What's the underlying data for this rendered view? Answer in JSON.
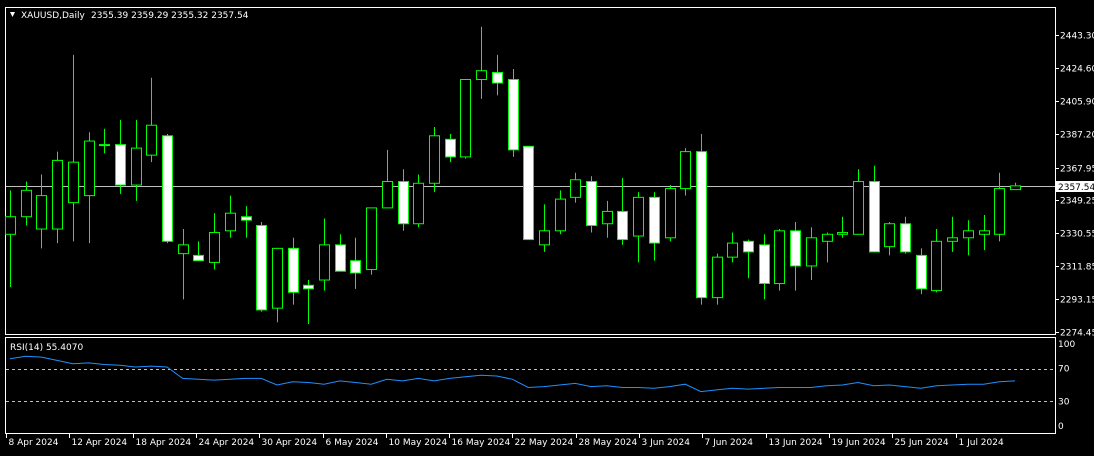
{
  "header": {
    "symbol_timeframe": "XAUUSD,Daily",
    "ohlc": "2355.39 2359.29 2355.32 2357.54"
  },
  "rsi_panel": {
    "label": "RSI(14) 55.4070",
    "levels": [
      "100",
      "70",
      "30",
      "0"
    ]
  },
  "current_price_label": "2357.54",
  "colors": {
    "background": "#000000",
    "candle_outline": "#00ff00",
    "bull_body": "#000000",
    "bear_body": "#ffffff",
    "rsi_line": "#1e90ff",
    "grid_text": "#ffffff"
  },
  "chart_data": [
    {
      "type": "candlestick",
      "title": "XAUUSD,Daily",
      "ylim": [
        2268,
        2463
      ],
      "y_ticks": [
        "2443.30",
        "2424.60",
        "2405.90",
        "2387.20",
        "2367.95",
        "2349.25",
        "2330.55",
        "2311.85",
        "2293.15",
        "2274.45"
      ],
      "x_ticks": [
        "8 Apr 2024",
        "12 Apr 2024",
        "18 Apr 2024",
        "24 Apr 2024",
        "30 Apr 2024",
        "6 May 2024",
        "10 May 2024",
        "16 May 2024",
        "22 May 2024",
        "28 May 2024",
        "3 Jun 2024",
        "7 Jun 2024",
        "13 Jun 2024",
        "19 Jun 2024",
        "25 Jun 2024",
        "1 Jul 2024"
      ],
      "candles": [
        {
          "o": 2330,
          "h": 2355,
          "l": 2300,
          "c": 2340
        },
        {
          "o": 2340,
          "h": 2360,
          "l": 2335,
          "c": 2355
        },
        {
          "o": 2333,
          "h": 2364,
          "l": 2322,
          "c": 2352
        },
        {
          "o": 2333,
          "h": 2377,
          "l": 2325,
          "c": 2372
        },
        {
          "o": 2348,
          "h": 2432,
          "l": 2326,
          "c": 2371
        },
        {
          "o": 2352,
          "h": 2388,
          "l": 2325,
          "c": 2383
        },
        {
          "o": 2381,
          "h": 2390,
          "l": 2376,
          "c": 2381
        },
        {
          "o": 2381,
          "h": 2395,
          "l": 2353,
          "c": 2358
        },
        {
          "o": 2358,
          "h": 2395,
          "l": 2349,
          "c": 2379
        },
        {
          "o": 2375,
          "h": 2419,
          "l": 2371,
          "c": 2392
        },
        {
          "o": 2386,
          "h": 2387,
          "l": 2325,
          "c": 2326
        },
        {
          "o": 2319,
          "h": 2333,
          "l": 2293,
          "c": 2324
        },
        {
          "o": 2318,
          "h": 2326,
          "l": 2315,
          "c": 2315
        },
        {
          "o": 2314,
          "h": 2342,
          "l": 2310,
          "c": 2331
        },
        {
          "o": 2332,
          "h": 2352,
          "l": 2328,
          "c": 2342
        },
        {
          "o": 2340,
          "h": 2346,
          "l": 2328,
          "c": 2338
        },
        {
          "o": 2335,
          "h": 2337,
          "l": 2286,
          "c": 2287
        },
        {
          "o": 2288,
          "h": 2322,
          "l": 2280,
          "c": 2322
        },
        {
          "o": 2322,
          "h": 2328,
          "l": 2290,
          "c": 2297
        },
        {
          "o": 2301,
          "h": 2304,
          "l": 2279,
          "c": 2299
        },
        {
          "o": 2304,
          "h": 2339,
          "l": 2298,
          "c": 2324
        },
        {
          "o": 2324,
          "h": 2330,
          "l": 2315,
          "c": 2309
        },
        {
          "o": 2315,
          "h": 2328,
          "l": 2299,
          "c": 2308
        },
        {
          "o": 2310,
          "h": 2342,
          "l": 2307,
          "c": 2345
        },
        {
          "o": 2345,
          "h": 2378,
          "l": 2345,
          "c": 2360
        },
        {
          "o": 2360,
          "h": 2367,
          "l": 2332,
          "c": 2336
        },
        {
          "o": 2336,
          "h": 2364,
          "l": 2334,
          "c": 2359
        },
        {
          "o": 2359,
          "h": 2391,
          "l": 2354,
          "c": 2386
        },
        {
          "o": 2384,
          "h": 2387,
          "l": 2371,
          "c": 2374
        },
        {
          "o": 2374,
          "h": 2418,
          "l": 2373,
          "c": 2418
        },
        {
          "o": 2418,
          "h": 2448,
          "l": 2407,
          "c": 2423
        },
        {
          "o": 2422,
          "h": 2432,
          "l": 2409,
          "c": 2416
        },
        {
          "o": 2418,
          "h": 2424,
          "l": 2374,
          "c": 2378
        },
        {
          "o": 2380,
          "h": 2380,
          "l": 2330,
          "c": 2327
        },
        {
          "o": 2324,
          "h": 2347,
          "l": 2320,
          "c": 2332
        },
        {
          "o": 2332,
          "h": 2355,
          "l": 2330,
          "c": 2350
        },
        {
          "o": 2351,
          "h": 2365,
          "l": 2348,
          "c": 2361
        },
        {
          "o": 2360,
          "h": 2363,
          "l": 2331,
          "c": 2335
        },
        {
          "o": 2336,
          "h": 2349,
          "l": 2328,
          "c": 2343
        },
        {
          "o": 2343,
          "h": 2362,
          "l": 2324,
          "c": 2327
        },
        {
          "o": 2329,
          "h": 2354,
          "l": 2314,
          "c": 2351
        },
        {
          "o": 2351,
          "h": 2354,
          "l": 2315,
          "c": 2325
        },
        {
          "o": 2328,
          "h": 2358,
          "l": 2326,
          "c": 2356
        },
        {
          "o": 2356,
          "h": 2379,
          "l": 2352,
          "c": 2377
        },
        {
          "o": 2377,
          "h": 2387,
          "l": 2290,
          "c": 2294
        },
        {
          "o": 2294,
          "h": 2319,
          "l": 2290,
          "c": 2317
        },
        {
          "o": 2317,
          "h": 2331,
          "l": 2314,
          "c": 2325
        },
        {
          "o": 2326,
          "h": 2327,
          "l": 2305,
          "c": 2320
        },
        {
          "o": 2324,
          "h": 2330,
          "l": 2293,
          "c": 2302
        },
        {
          "o": 2302,
          "h": 2333,
          "l": 2298,
          "c": 2332
        },
        {
          "o": 2332,
          "h": 2337,
          "l": 2298,
          "c": 2312
        },
        {
          "o": 2312,
          "h": 2334,
          "l": 2304,
          "c": 2328
        },
        {
          "o": 2326,
          "h": 2331,
          "l": 2314,
          "c": 2330
        },
        {
          "o": 2330,
          "h": 2340,
          "l": 2328,
          "c": 2331
        },
        {
          "o": 2330,
          "h": 2367,
          "l": 2330,
          "c": 2360
        },
        {
          "o": 2360,
          "h": 2369,
          "l": 2320,
          "c": 2320
        },
        {
          "o": 2323,
          "h": 2337,
          "l": 2318,
          "c": 2336
        },
        {
          "o": 2336,
          "h": 2340,
          "l": 2319,
          "c": 2320
        },
        {
          "o": 2318,
          "h": 2322,
          "l": 2296,
          "c": 2299
        },
        {
          "o": 2298,
          "h": 2333,
          "l": 2297,
          "c": 2326
        },
        {
          "o": 2326,
          "h": 2340,
          "l": 2320,
          "c": 2328
        },
        {
          "o": 2328,
          "h": 2338,
          "l": 2318,
          "c": 2332
        },
        {
          "o": 2330,
          "h": 2341,
          "l": 2321,
          "c": 2332
        },
        {
          "o": 2330,
          "h": 2365,
          "l": 2326,
          "c": 2356
        },
        {
          "o": 2355.39,
          "h": 2359.29,
          "l": 2355.32,
          "c": 2357.54
        }
      ],
      "current_price": 2357.54
    },
    {
      "type": "line",
      "title": "RSI(14) 55.4070",
      "ylim": [
        0,
        100
      ],
      "levels": [
        70,
        30
      ],
      "y_ticks": [
        "100",
        "70",
        "30",
        "0"
      ],
      "series": [
        {
          "values": [
            82,
            85,
            84,
            80,
            76,
            77,
            75,
            74,
            72,
            73,
            72,
            58,
            57,
            56,
            57,
            58,
            58,
            50,
            54,
            53,
            51,
            55,
            53,
            51,
            57,
            55,
            58,
            55,
            58,
            60,
            62,
            61,
            57,
            47,
            48,
            50,
            52,
            48,
            49,
            47,
            47,
            46,
            48,
            51,
            42,
            44,
            46,
            45,
            46,
            47,
            47,
            47,
            49,
            50,
            53,
            49,
            50,
            48,
            46,
            49,
            50,
            51,
            51,
            54,
            55
          ]
        }
      ]
    }
  ]
}
